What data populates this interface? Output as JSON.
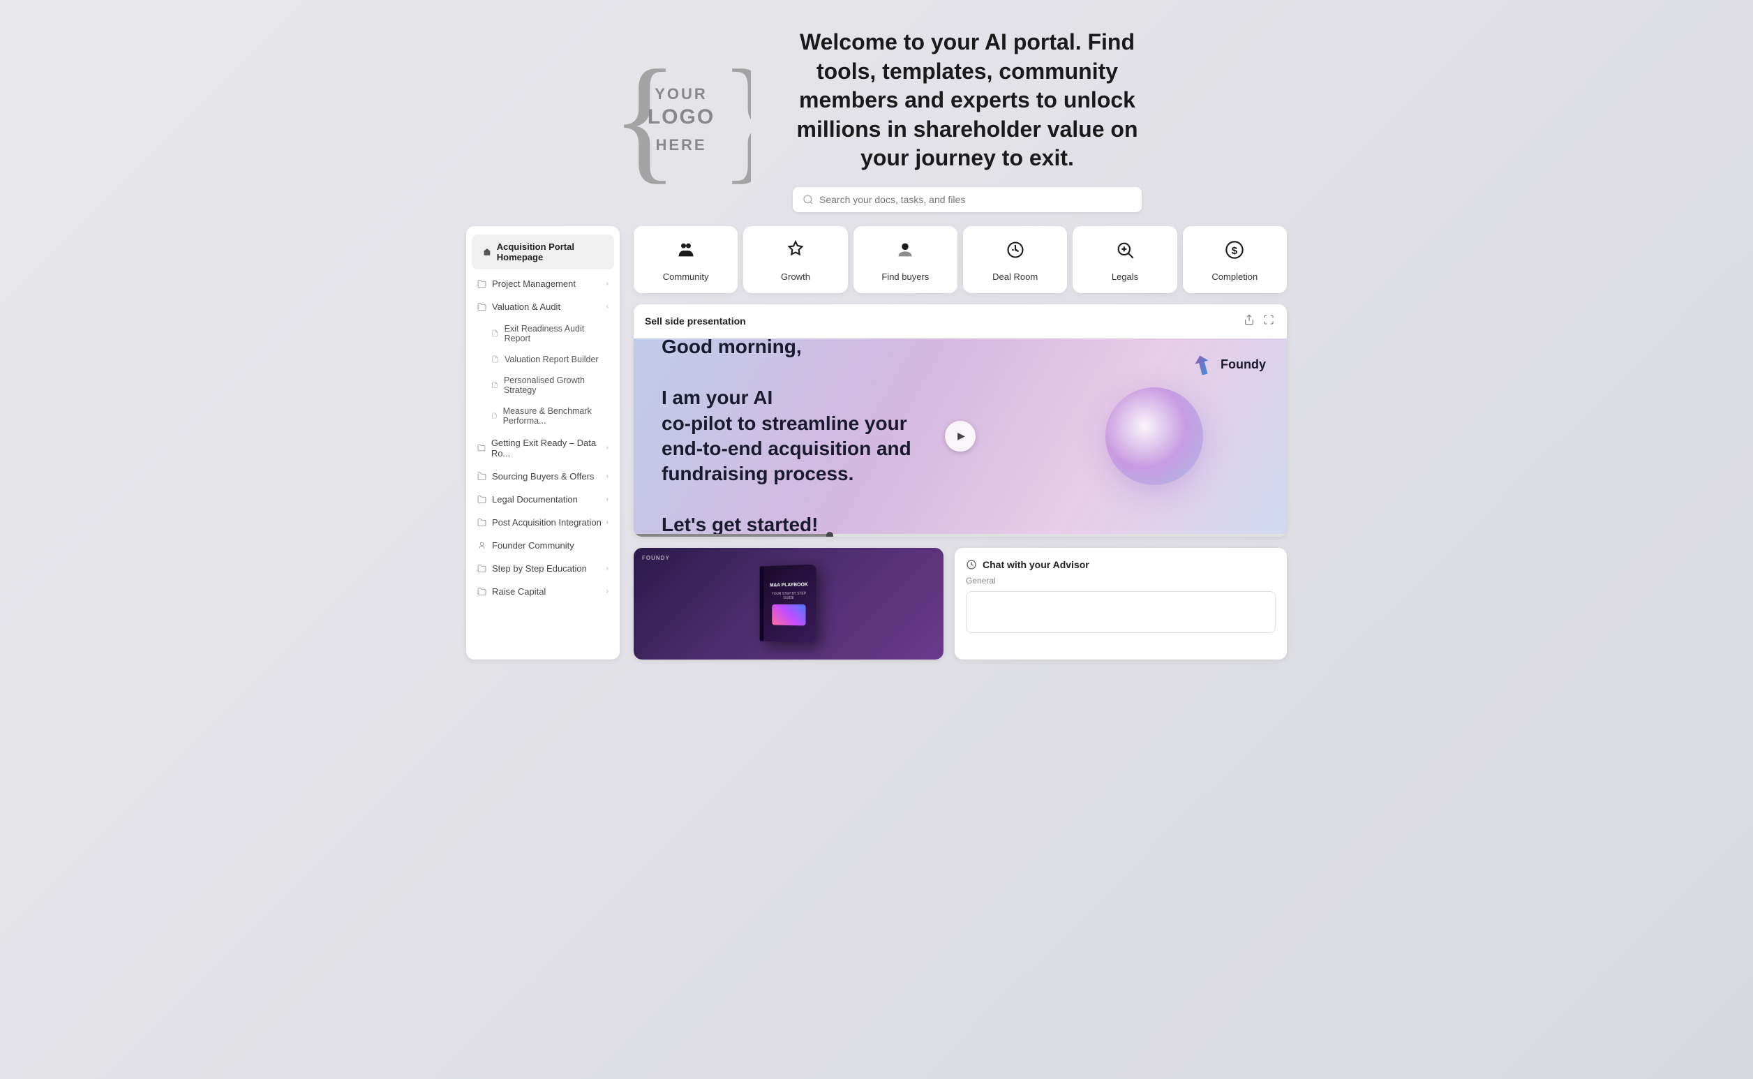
{
  "hero": {
    "logo_line1": "YOUR",
    "logo_line2": "LOGO",
    "logo_line3": "HERE",
    "headline": "Welcome to your AI portal. Find tools, templates, community members and experts to unlock millions in shareholder value on your journey to exit.",
    "search_placeholder": "Search your docs, tasks, and files"
  },
  "sidebar": {
    "home_label": "Acquisition Portal Homepage",
    "items": [
      {
        "id": "project-management",
        "label": "Project Management",
        "has_arrow": true
      },
      {
        "id": "valuation-audit",
        "label": "Valuation & Audit",
        "has_arrow": true
      },
      {
        "id": "exit-readiness",
        "label": "Exit Readiness Audit Report",
        "is_sub": true
      },
      {
        "id": "valuation-report",
        "label": "Valuation Report Builder",
        "is_sub": true
      },
      {
        "id": "personalised-growth",
        "label": "Personalised Growth Strategy",
        "is_sub": true
      },
      {
        "id": "measure-benchmark",
        "label": "Measure & Benchmark Performa...",
        "is_sub": true
      },
      {
        "id": "getting-exit-ready",
        "label": "Getting Exit Ready – Data Ro...",
        "has_arrow": true
      },
      {
        "id": "sourcing-buyers",
        "label": "Sourcing Buyers & Offers",
        "has_arrow": true
      },
      {
        "id": "legal-documentation",
        "label": "Legal Documentation",
        "has_arrow": true
      },
      {
        "id": "post-acquisition",
        "label": "Post Acquisition Integration",
        "has_arrow": true
      },
      {
        "id": "founder-community",
        "label": "Founder Community",
        "has_arrow": false,
        "is_community": true
      },
      {
        "id": "step-by-step",
        "label": "Step by Step Education",
        "has_arrow": true
      },
      {
        "id": "raise-capital",
        "label": "Raise Capital",
        "has_arrow": true
      }
    ]
  },
  "icon_nav": [
    {
      "id": "community",
      "label": "Community",
      "icon": "👥"
    },
    {
      "id": "growth",
      "label": "Growth",
      "icon": "✨"
    },
    {
      "id": "find-buyers",
      "label": "Find buyers",
      "icon": "👤"
    },
    {
      "id": "deal-room",
      "label": "Deal Room",
      "icon": "📊"
    },
    {
      "id": "legals",
      "label": "Legals",
      "icon": "🔍"
    },
    {
      "id": "completion",
      "label": "Completion",
      "icon": "💲"
    }
  ],
  "video_card": {
    "title": "Sell side presentation",
    "greeting": "Good morning,",
    "tagline_line1": "I am your AI",
    "tagline_line2": "co-pilot to streamline your",
    "tagline_line3": "end-to-end acquisition and",
    "tagline_line4": "fundraising process.",
    "cta": "Let's get started!",
    "brand_name": "Foundy"
  },
  "playbook": {
    "brand": "FOUNDY",
    "title": "M&A PLAYBOOK",
    "subtitle": "YOUR STEP BY STEP GUIDE"
  },
  "chat": {
    "title": "Chat with your Advisor",
    "label": "General",
    "placeholder": ""
  }
}
